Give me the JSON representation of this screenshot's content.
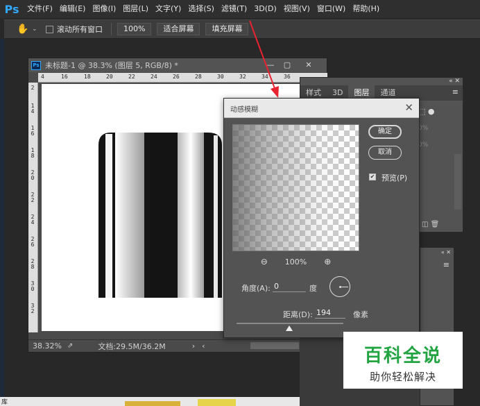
{
  "menubar": {
    "logo": "Ps",
    "items": [
      "文件(F)",
      "编辑(E)",
      "图像(I)",
      "图层(L)",
      "文字(Y)",
      "选择(S)",
      "滤镜(T)",
      "3D(D)",
      "视图(V)",
      "窗口(W)",
      "帮助(H)"
    ]
  },
  "options": {
    "hand_icon": "hand-tool-icon",
    "scroll_all_label": "滚动所有窗口",
    "zoom_100": "100%",
    "fit_screen": "适合屏幕",
    "fill_screen": "填充屏幕"
  },
  "document": {
    "title": "未标题-1 @ 38.3% (图层 5, RGB/8) *",
    "ruler_top": [
      "4",
      "16",
      "18",
      "20",
      "22",
      "24",
      "26",
      "28",
      "30",
      "32",
      "34",
      "36"
    ],
    "ruler_left": [
      "2",
      "1 4",
      "1 6",
      "1 8",
      "2 0",
      "2 2",
      "2 4",
      "2 6",
      "2 8",
      "3 0",
      "3 2"
    ],
    "zoom": "38.32%",
    "doc_info": "文档:29.5M/36.2M"
  },
  "layers_panel": {
    "tabs": [
      "样式",
      "3D",
      "图层",
      "通道"
    ],
    "active_tab": "图层",
    "opacity_1": "0%",
    "opacity_2": "0%"
  },
  "dialog": {
    "title": "动感模糊",
    "ok": "确定",
    "cancel": "取消",
    "preview_label": "预览(P)",
    "zoom": "100%",
    "angle_label": "角度(A):",
    "angle_value": "0",
    "degree_unit": "度",
    "distance_label": "距离(D):",
    "distance_value": "194",
    "pixel_unit": "像素"
  },
  "watermark": {
    "main": "百科全说",
    "sub": "助你轻松解决"
  },
  "bottom": {
    "library_label": "库"
  },
  "colors": {
    "accent": "#31a8ff",
    "arrow": "#e8232f",
    "watermark_green": "#23a442"
  }
}
